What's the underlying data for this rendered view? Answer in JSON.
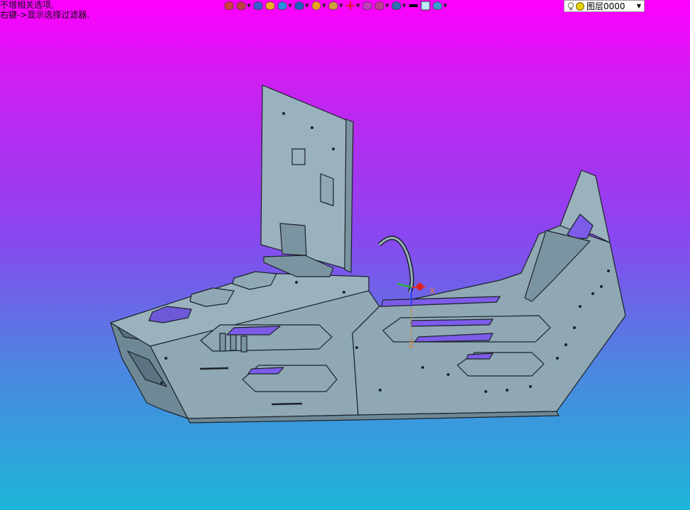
{
  "status": {
    "line1": "不增相关选项,",
    "line2": "右键->显示选择过滤器."
  },
  "toolbar": {
    "buttons": [
      {
        "name": "select-filter-icon",
        "color": "#d04040",
        "caret": false
      },
      {
        "name": "layer-filter-icon",
        "color": "#c04040",
        "caret": true
      },
      {
        "name": "pen-icon",
        "color": "#3a5fd0",
        "caret": false
      },
      {
        "name": "solid-render-icon",
        "color": "#f0b020",
        "caret": false
      },
      {
        "name": "cube-icon",
        "color": "#2a8fe0",
        "caret": true
      },
      {
        "name": "view-cube-icon",
        "color": "#2060c0",
        "caret": true
      },
      {
        "name": "ball-icon",
        "color": "#f0a020",
        "caret": true
      },
      {
        "name": "zoom-icon",
        "color": "#d0a040",
        "caret": true
      },
      {
        "name": "pan-icon",
        "color": "#d02020",
        "caret": true
      },
      {
        "name": "frame-icon",
        "color": "#c040c0",
        "caret": false
      },
      {
        "name": "section-icon",
        "color": "#c04090",
        "caret": true
      },
      {
        "name": "display-icon",
        "color": "#3070b0",
        "caret": true
      },
      {
        "name": "line-color-icon",
        "color": "#000000",
        "caret": false
      },
      {
        "name": "fill-color-icon",
        "color": "#bfe8f8",
        "caret": false
      },
      {
        "name": "layer-stack-icon",
        "color": "#3aa0d0",
        "caret": true
      }
    ],
    "layer": {
      "label": "图层0000"
    }
  },
  "axes": {
    "x": "X",
    "z": "Z"
  },
  "colors": {
    "body": "#8fa8b4",
    "body_dark": "#6e8896",
    "edge": "#1a2228",
    "cutout_through": "#7c5ce8"
  }
}
